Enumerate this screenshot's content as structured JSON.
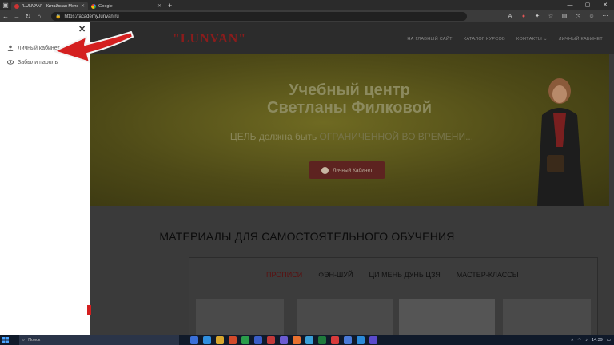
{
  "browser": {
    "tabs": [
      {
        "title": "\"LUNVAN\" - Китайская Метафизи...",
        "active": true
      },
      {
        "title": "Google",
        "active": false
      }
    ],
    "url": "https://academy.lunvan.ru"
  },
  "site": {
    "logo": "\"LUNVAN\"",
    "nav": [
      "НА ГЛАВНЫЙ САЙТ",
      "КАТАЛОГ КУРСОВ",
      "КОНТАКТЫ ⌄",
      "ЛИЧНЫЙ КАБИНЕТ"
    ],
    "hero_title_line1": "Учебный центр",
    "hero_title_line2": "Светланы Филковой",
    "hero_sub_a": "ЦЕЛЬ должна быть ",
    "hero_sub_b": "ОГРАНИЧЕННОЙ ВО ВРЕМЕНИ...",
    "hero_button": "Личный Кабинет",
    "section_title": "МАТЕРИАЛЫ ДЛЯ САМОСТОЯТЕЛЬНОГО ОБУЧЕНИЯ",
    "categories": [
      "ПРОПИСИ",
      "ФЭН-ШУЙ",
      "ЦИ МЕНЬ ДУНЬ ЦЗЯ",
      "МАСТЕР-КЛАССЫ"
    ]
  },
  "sidebar": {
    "items": [
      "Личный кабинет",
      "Забыли пароль"
    ]
  },
  "taskbar": {
    "search_placeholder": "Поиск",
    "time": "14:39"
  },
  "colors": {
    "logo": "#8b1c1c",
    "arrow": "#d42020",
    "hero_bg": "#6f6a22"
  }
}
